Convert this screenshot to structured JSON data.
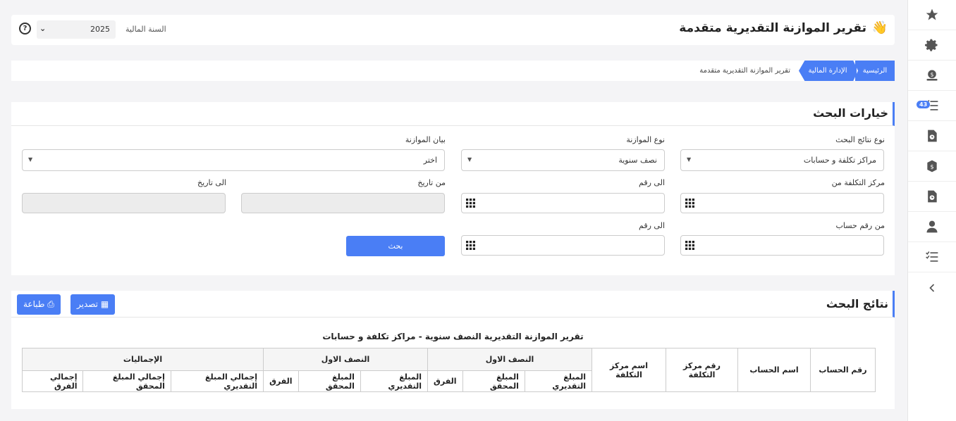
{
  "header": {
    "title": "تقرير الموازنة التقديرية متقدمة",
    "wave": "👋",
    "fiscal_year_label": "السنة المالية",
    "fiscal_year_value": "2025",
    "help": "?"
  },
  "breadcrumb": {
    "home": "الرئيسية",
    "finance": "الإدارة المالية",
    "current": "تقرير الموازنة التقديرية متقدمة"
  },
  "search": {
    "title": "خيارات البحث",
    "result_type_label": "نوع نتائج البحث",
    "result_type_value": "مراكز تكلفة و حسابات",
    "budget_type_label": "نوع الموازنة",
    "budget_type_value": "نصف سنوية",
    "budget_statement_label": "بيان الموازنة",
    "budget_statement_value": "اختر",
    "cost_center_from_label": "مركز التكلفة من",
    "to_number_label": "الى رقم",
    "from_date_label": "من تاريخ",
    "to_date_label": "الى تاريخ",
    "account_from_label": "من رقم حساب",
    "account_to_label": "الى رقم",
    "search_button": "بحث"
  },
  "results": {
    "title": "نتائج البحث",
    "export_button": "تصدير",
    "print_button": "طباعة",
    "report_title": "تقرير الموازنة التقديرية النصف سنوية - مراكز تكلفة و حسابات",
    "columns": {
      "account_no": "رقم الحساب",
      "account_name": "اسم الحساب",
      "cost_center_no": "رقم مركز التكلفة",
      "cost_center_name": "اسم مركز التكلفة",
      "half1": "النصف الاول",
      "half2": "النصف الاول",
      "totals": "الإجماليات",
      "estimated": "المبلغ التقديري",
      "actual": "المبلغ المحقق",
      "diff": "الفرق",
      "total_estimated": "إجمالي المبلغ التقديري",
      "total_actual": "إجمالي المبلغ المحقق",
      "total_diff": "إجمالي الفرق"
    }
  },
  "sidebar": {
    "badge": "43",
    "icons": [
      "star-icon",
      "gear-icon",
      "money-bag-icon",
      "tasks-icon",
      "file-clock-icon",
      "coin-icon",
      "file-clock-icon",
      "user-tie-icon",
      "checklist-icon",
      "chevron-left-icon"
    ]
  }
}
